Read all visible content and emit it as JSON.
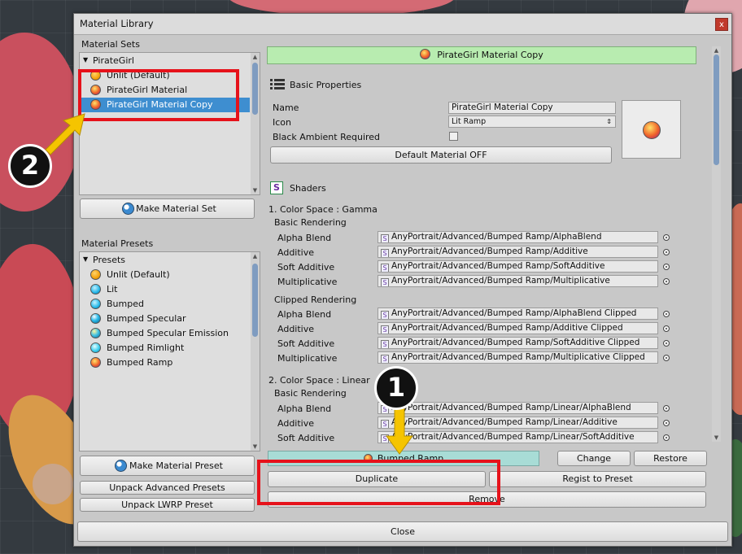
{
  "window": {
    "title": "Material Library",
    "close_glyph": "x"
  },
  "material_sets": {
    "header": "Material Sets",
    "root": "PirateGirl",
    "items": [
      {
        "label": "Unlit (Default)",
        "icon": "unlit-ball-icon"
      },
      {
        "label": "PirateGirl Material",
        "icon": "ramp-ball-icon"
      },
      {
        "label": "PirateGirl Material Copy",
        "icon": "ramp-ball-icon",
        "selected": true
      }
    ],
    "make_button": "Make Material Set"
  },
  "material_presets": {
    "header": "Material Presets",
    "root": "Presets",
    "items": [
      {
        "label": "Unlit (Default)",
        "icon": "unlit"
      },
      {
        "label": "Lit",
        "icon": "lit"
      },
      {
        "label": "Bumped",
        "icon": "bumped"
      },
      {
        "label": "Bumped Specular",
        "icon": "spec"
      },
      {
        "label": "Bumped Specular Emission",
        "icon": "emis"
      },
      {
        "label": "Bumped Rimlight",
        "icon": "rim"
      },
      {
        "label": "Bumped Ramp",
        "icon": "ramp"
      }
    ],
    "make_preset_button": "Make Material Preset",
    "unpack_advanced_button": "Unpack Advanced Presets",
    "unpack_lwrp_button": "Unpack LWRP Preset"
  },
  "detail": {
    "header_title": "PirateGirl Material Copy",
    "basic_properties": "Basic Properties",
    "name_label": "Name",
    "name_value": "PirateGirl Material Copy",
    "icon_label": "Icon",
    "icon_value": "Lit Ramp",
    "black_ambient_label": "Black Ambient Required",
    "default_material_button": "Default Material OFF",
    "shaders_label": "Shaders",
    "sections": [
      {
        "title": "1. Color Space : Gamma",
        "groups": [
          {
            "title": "Basic Rendering",
            "rows": [
              {
                "label": "Alpha Blend",
                "value": "AnyPortrait/Advanced/Bumped Ramp/AlphaBlend"
              },
              {
                "label": "Additive",
                "value": "AnyPortrait/Advanced/Bumped Ramp/Additive"
              },
              {
                "label": "Soft Additive",
                "value": "AnyPortrait/Advanced/Bumped Ramp/SoftAdditive"
              },
              {
                "label": "Multiplicative",
                "value": "AnyPortrait/Advanced/Bumped Ramp/Multiplicative"
              }
            ]
          },
          {
            "title": "Clipped Rendering",
            "rows": [
              {
                "label": "Alpha Blend",
                "value": "AnyPortrait/Advanced/Bumped Ramp/AlphaBlend Clipped"
              },
              {
                "label": "Additive",
                "value": "AnyPortrait/Advanced/Bumped Ramp/Additive Clipped"
              },
              {
                "label": "Soft Additive",
                "value": "AnyPortrait/Advanced/Bumped Ramp/SoftAdditive Clipped"
              },
              {
                "label": "Multiplicative",
                "value": "AnyPortrait/Advanced/Bumped Ramp/Multiplicative Clipped"
              }
            ]
          }
        ]
      },
      {
        "title": "2. Color Space : Linear",
        "groups": [
          {
            "title": "Basic Rendering",
            "rows": [
              {
                "label": "Alpha Blend",
                "value": "AnyPortrait/Advanced/Bumped Ramp/Linear/AlphaBlend"
              },
              {
                "label": "Additive",
                "value": "AnyPortrait/Advanced/Bumped Ramp/Linear/Additive"
              },
              {
                "label": "Soft Additive",
                "value": "AnyPortrait/Advanced/Bumped Ramp/Linear/SoftAdditive"
              }
            ]
          }
        ]
      }
    ],
    "preset_bar": "Bumped Ramp",
    "change_button": "Change",
    "restore_button": "Restore",
    "duplicate_button": "Duplicate",
    "regist_button": "Regist to Preset",
    "remove_button": "Remove"
  },
  "close_button": "Close",
  "annotations": {
    "badge_one": "1",
    "badge_two": "2"
  },
  "colors": {
    "accent_selected": "#3e8ed0",
    "header_green": "#b8ecb0",
    "highlight_red": "#e6121b",
    "arrow_yellow": "#f5c400"
  }
}
